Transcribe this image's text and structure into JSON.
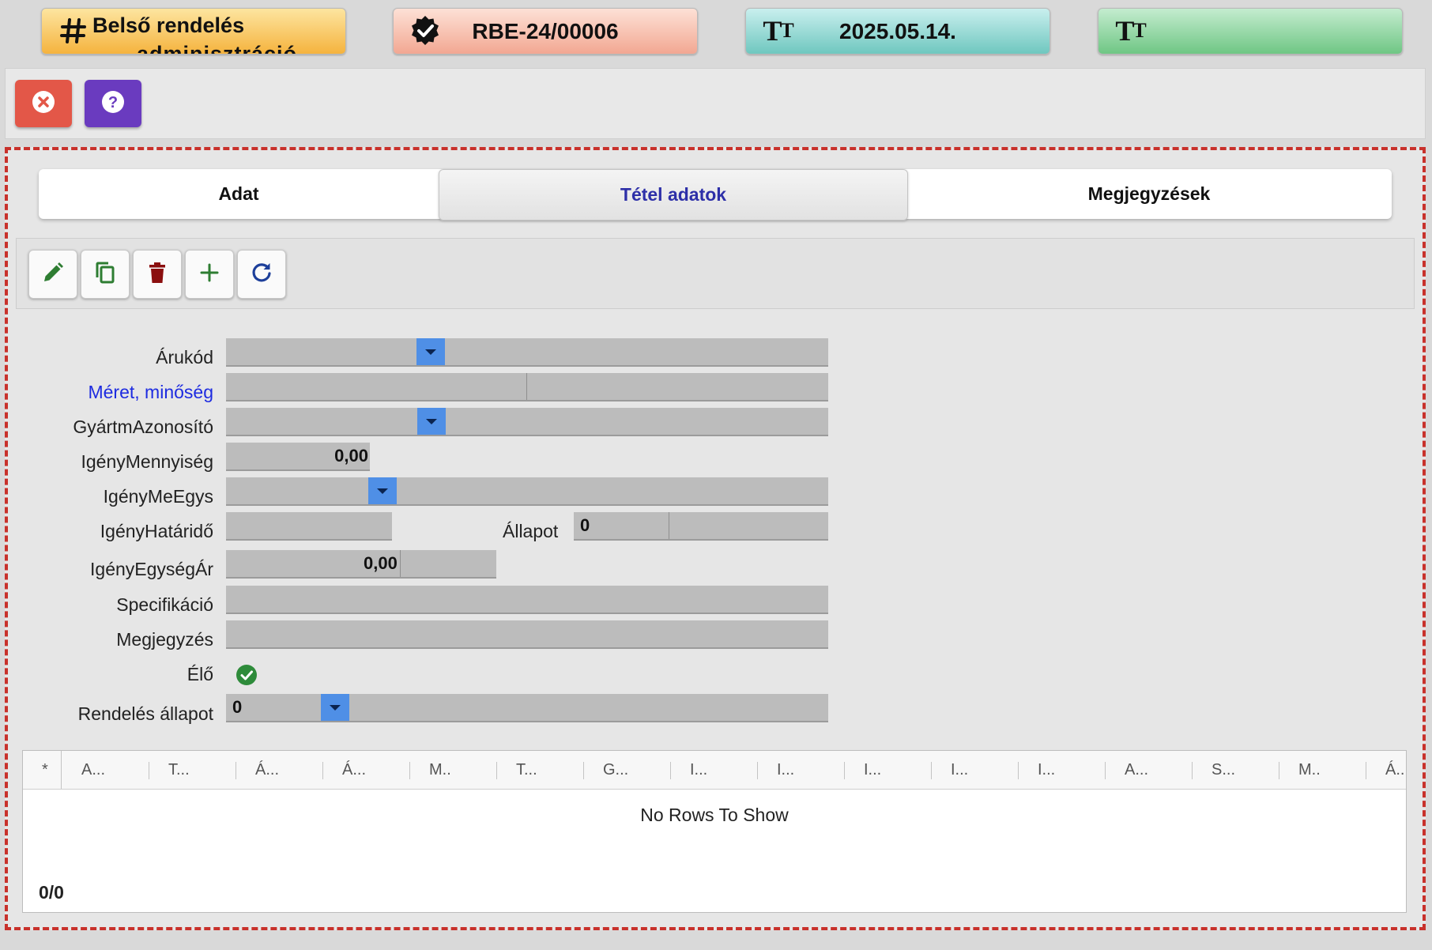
{
  "header": {
    "card1": {
      "icon": "hash-icon",
      "title": "Belső rendelés",
      "subtitle": "adminisztráció"
    },
    "card2": {
      "icon": "verified-badge-icon",
      "value": "RBE-24/00006"
    },
    "card3": {
      "icon": "text-size-icon",
      "value": "2025.05.14."
    },
    "card4": {
      "icon": "text-size-icon",
      "value": ""
    }
  },
  "toolbar": {
    "close_icon": "close-circle-icon",
    "help_icon": "help-circle-icon"
  },
  "tabs": [
    {
      "label": "Adat",
      "active": false
    },
    {
      "label": "Tétel adatok",
      "active": true
    },
    {
      "label": "Megjegyzések",
      "active": false
    }
  ],
  "actions": [
    {
      "name": "edit-button",
      "icon": "pencil-icon"
    },
    {
      "name": "copy-button",
      "icon": "copy-icon"
    },
    {
      "name": "delete-button",
      "icon": "trash-icon"
    },
    {
      "name": "add-button",
      "icon": "plus-icon"
    },
    {
      "name": "refresh-button",
      "icon": "refresh-icon"
    }
  ],
  "form": {
    "arukod": {
      "label": "Árukód",
      "value": ""
    },
    "meret": {
      "label": "Méret, minőség",
      "value": ""
    },
    "gyartm": {
      "label": "GyártmAzonosító",
      "value": ""
    },
    "igeny_mennyiseg": {
      "label": "IgényMennyiség",
      "value": "0,00"
    },
    "igeny_meegys": {
      "label": "IgényMeEgys",
      "value": ""
    },
    "igeny_hatarido": {
      "label": "IgényHatáridő",
      "value": ""
    },
    "allapot": {
      "label": "Állapot",
      "value": "0"
    },
    "igeny_egysegar": {
      "label": "IgényEgységÁr",
      "value": "0,00"
    },
    "specifikacio": {
      "label": "Specifikáció",
      "value": ""
    },
    "megjegyzes": {
      "label": "Megjegyzés",
      "value": ""
    },
    "elo": {
      "label": "Élő",
      "checked": true
    },
    "rendeles_allapot": {
      "label": "Rendelés állapot",
      "value": "0"
    }
  },
  "grid": {
    "columns": [
      "*",
      "A...",
      "T...",
      "Á...",
      "Á...",
      "M..",
      "T...",
      "G...",
      "I...",
      "I...",
      "I...",
      "I...",
      "I...",
      "A...",
      "S...",
      "M..",
      "Á.."
    ],
    "empty_text": "No Rows To Show",
    "count": "0/0"
  },
  "colors": {
    "accent_close": "#e35748",
    "accent_help": "#6a3bbf",
    "dropdown": "#4f8fe6",
    "active_tab_text": "#2d2fa8",
    "frame_border": "#c8312b"
  }
}
